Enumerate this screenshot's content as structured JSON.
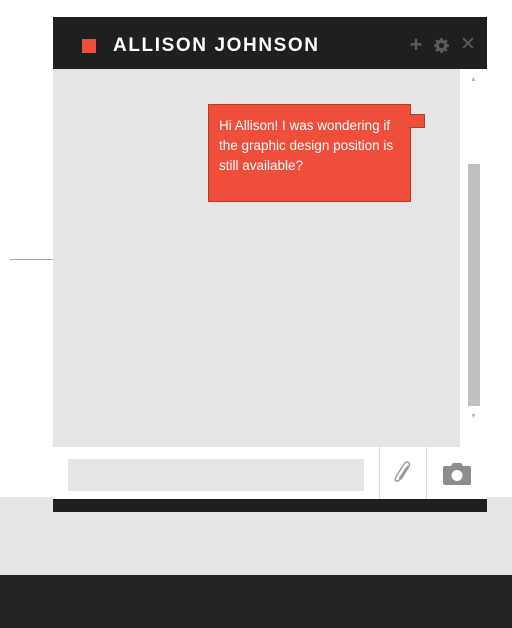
{
  "chat": {
    "contact_name": "ALLISON JOHNSON",
    "status_color": "#ef4e3a",
    "header_icons": [
      "add-icon",
      "gear-icon",
      "close-icon"
    ],
    "messages": [
      {
        "text": "Hi Allison! I was wondering if the graphic design position is still available?",
        "bubble_color": "#ef4e3a"
      }
    ],
    "input": {
      "value": "",
      "placeholder": ""
    },
    "actions": [
      "paperclip-icon",
      "camera-icon"
    ]
  },
  "colors": {
    "accent": "#ef4e3a",
    "header": "#1f1f1f",
    "message_area": "#e5e5e7",
    "footer": "#222222"
  }
}
